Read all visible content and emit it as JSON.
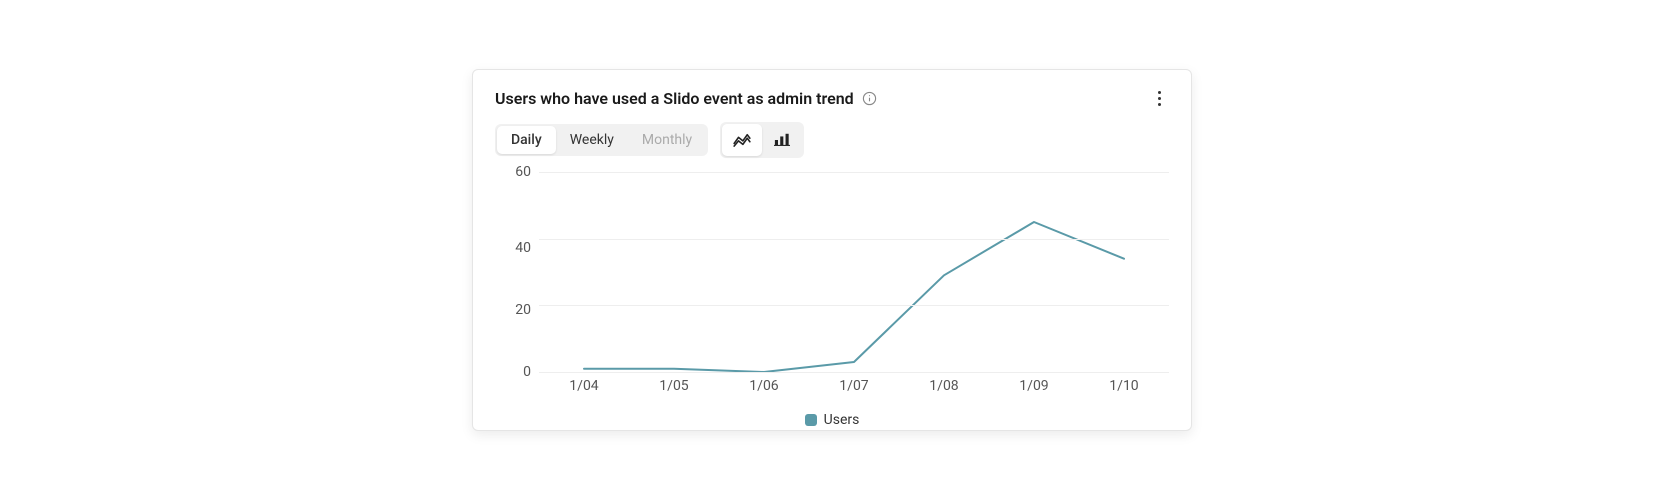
{
  "title": "Users who have used a Slido event as admin trend",
  "tabs": {
    "daily": "Daily",
    "weekly": "Weekly",
    "monthly": "Monthly",
    "active": "Daily",
    "disabled": [
      "Monthly"
    ]
  },
  "view": {
    "active": "line"
  },
  "legend": {
    "series1": "Users",
    "color": "#5a9aa8"
  },
  "y_ticks": [
    "60",
    "40",
    "20",
    "0"
  ],
  "x_ticks": [
    "1/04",
    "1/05",
    "1/06",
    "1/07",
    "1/08",
    "1/09",
    "1/10"
  ],
  "chart_data": {
    "type": "line",
    "title": "Users who have used a Slido event as admin trend",
    "xlabel": "",
    "ylabel": "",
    "ylim": [
      0,
      60
    ],
    "categories": [
      "1/04",
      "1/05",
      "1/06",
      "1/07",
      "1/08",
      "1/09",
      "1/10"
    ],
    "series": [
      {
        "name": "Users",
        "color": "#5a9aa8",
        "values": [
          1,
          1,
          0,
          3,
          29,
          45,
          34
        ]
      }
    ],
    "grid": true,
    "legend_position": "bottom"
  }
}
